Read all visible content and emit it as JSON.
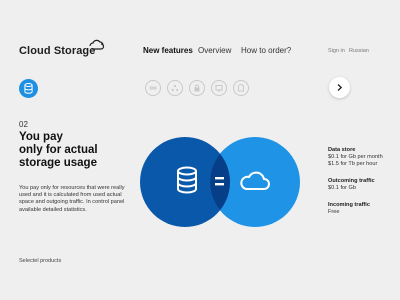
{
  "header": {
    "brand": "Cloud Storage",
    "nav": [
      "New features",
      "Overview",
      "How to order?"
    ],
    "sign_in": "Sign in",
    "language": "Russian"
  },
  "features": {
    "active_icon": "database-icon",
    "icons": [
      "infinity-icon",
      "network-icon",
      "lock-icon",
      "monitor-icon",
      "archive-icon"
    ],
    "next_icon": "chevron-right-icon"
  },
  "main": {
    "number": "02",
    "heading_lines": [
      "You pay",
      "only for actual",
      "storage usage"
    ],
    "description": "You pay only for resources that were really used and it is calculated from used actual space and outgoing traffic. In control panel available detailed statistics."
  },
  "pricing": {
    "data_store": {
      "title": "Data store",
      "lines": [
        "$0.1 for Gb per month",
        "$1.5 for Tb per hour"
      ]
    },
    "outcoming": {
      "title": "Outcoming traffic",
      "lines": [
        "$0.1 for Gb"
      ]
    },
    "incoming": {
      "title": "Incoming traffic",
      "lines": [
        "Free"
      ]
    }
  },
  "footer": {
    "selected_products": "Selectel products"
  },
  "colors": {
    "dark_blue": "#0a58aa",
    "light_blue": "#1f94e6",
    "overlap": "#063f88",
    "active_feature": "#1e8fe1",
    "background": "#efefef"
  }
}
